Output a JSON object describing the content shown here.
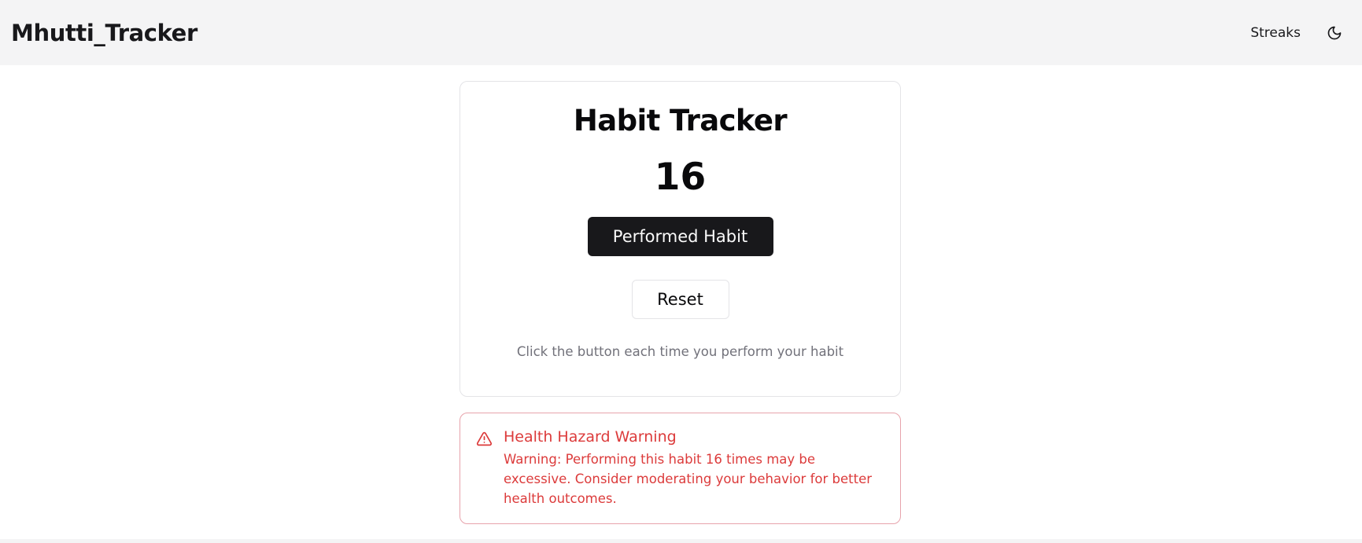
{
  "header": {
    "brand": "Mhutti_Tracker",
    "nav_streaks": "Streaks",
    "theme_icon": "moon-icon"
  },
  "tracker": {
    "title": "Habit Tracker",
    "count": "16",
    "perform_label": "Performed Habit",
    "reset_label": "Reset",
    "hint": "Click the button each time you perform your habit"
  },
  "alert": {
    "icon": "warning-triangle-icon",
    "title": "Health Hazard Warning",
    "message": "Warning: Performing this habit 16 times may be excessive. Consider moderating your behavior for better health outcomes."
  },
  "colors": {
    "header_bg": "#f4f4f5",
    "primary": "#18181b",
    "danger": "#dc3b3b",
    "muted": "#71717a"
  }
}
